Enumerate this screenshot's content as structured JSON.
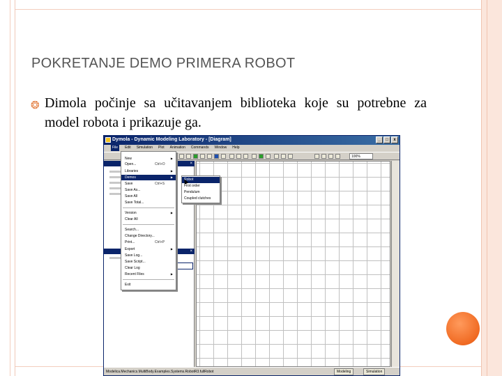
{
  "slide": {
    "title": "POKRETANJE DEMO PRIMERA ROBOT",
    "body": "Dimola počinje sa učitavanjem biblioteka koje su potrebne za model robota i prikazuje ga.",
    "accent_color": "#e27a3c"
  },
  "window": {
    "title": "Dymola - Dynamic Modeling Laboratory - [Diagram]",
    "buttons": [
      "_",
      "□",
      "x"
    ],
    "menu": [
      "File",
      "Edit",
      "Simulation",
      "Plot",
      "Animation",
      "Commands",
      "Window",
      "Help"
    ],
    "active_menu": "File",
    "zoom": "100%",
    "status": "Modelica.Mechanics.MultiBody.Examples.Systems.RobotR3.fullRobot",
    "modes": [
      "Modeling",
      "Simulation"
    ]
  },
  "file_menu": {
    "items": [
      {
        "label": "New",
        "shortcut": "",
        "submenu": true
      },
      {
        "label": "Open...",
        "shortcut": "Ctrl+O",
        "submenu": false
      },
      {
        "label": "Libraries",
        "shortcut": "",
        "submenu": true
      },
      {
        "label": "Demos",
        "shortcut": "",
        "submenu": true
      },
      {
        "label": "Save",
        "shortcut": "Ctrl+S",
        "submenu": false
      },
      {
        "label": "Save As...",
        "shortcut": "",
        "submenu": false
      },
      {
        "label": "Save All",
        "shortcut": "",
        "submenu": false
      },
      {
        "label": "Save Total...",
        "shortcut": "",
        "submenu": false
      },
      {
        "label": "Version",
        "shortcut": "",
        "submenu": true
      },
      {
        "label": "Clear All",
        "shortcut": "",
        "submenu": false
      },
      {
        "label": "Search...",
        "shortcut": "",
        "submenu": false
      },
      {
        "label": "Change Directory...",
        "shortcut": "",
        "submenu": false
      },
      {
        "label": "Print...",
        "shortcut": "Ctrl+P",
        "submenu": false
      },
      {
        "label": "Export",
        "shortcut": "",
        "submenu": true
      },
      {
        "label": "Save Log...",
        "shortcut": "",
        "submenu": false
      },
      {
        "label": "Save Script...",
        "shortcut": "",
        "submenu": false
      },
      {
        "label": "Clear Log",
        "shortcut": "",
        "submenu": false
      },
      {
        "label": "Recent Files",
        "shortcut": "",
        "submenu": true
      },
      {
        "label": "Exit",
        "shortcut": "",
        "submenu": false
      }
    ],
    "highlighted": "Demos"
  },
  "demos_submenu": {
    "items": [
      "Robot",
      "First order",
      "Pendulum",
      "Coupled clutches"
    ],
    "highlighted": "Robot"
  }
}
